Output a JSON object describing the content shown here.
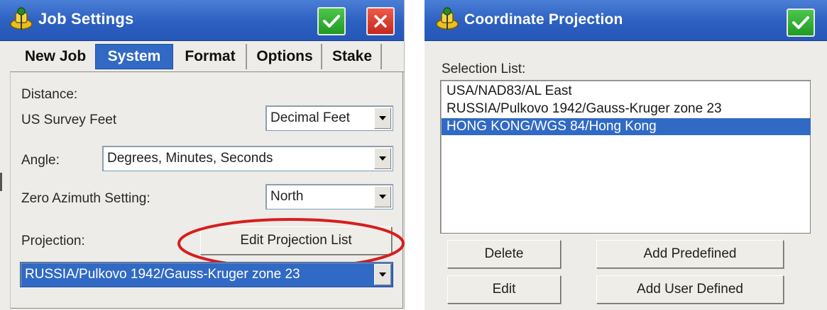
{
  "job_settings": {
    "title": "Job Settings",
    "tabs": [
      {
        "label": "New Job"
      },
      {
        "label": "System"
      },
      {
        "label": "Format"
      },
      {
        "label": "Options"
      },
      {
        "label": "Stake"
      }
    ],
    "active_tab": "System",
    "distance_label": "Distance:",
    "distance_unit_label": "US Survey Feet",
    "distance_format_value": "Decimal Feet",
    "angle_label": "Angle:",
    "angle_value": "Degrees, Minutes, Seconds",
    "zero_azimuth_label": "Zero Azimuth Setting:",
    "zero_azimuth_value": "North",
    "projection_label": "Projection:",
    "edit_projection_button": "Edit Projection List",
    "projection_value": "RUSSIA/Pulkovo 1942/Gauss-Kruger zone 23"
  },
  "coordinate_projection": {
    "title": "Coordinate Projection",
    "selection_list_label": "Selection List:",
    "items": [
      {
        "label": "USA/NAD83/AL East"
      },
      {
        "label": "RUSSIA/Pulkovo 1942/Gauss-Kruger zone 23"
      },
      {
        "label": "HONG KONG/WGS 84/Hong Kong"
      }
    ],
    "selected_item": "HONG KONG/WGS 84/Hong Kong",
    "buttons": {
      "delete": "Delete",
      "add_predefined": "Add Predefined",
      "edit": "Edit",
      "add_user_defined": "Add User Defined"
    }
  },
  "colors": {
    "titlebar": "#2c5fc0",
    "selection": "#316ac5",
    "ok_button": "#1f9a22",
    "close_button": "#c4281c",
    "highlight_ring": "#d61e1e"
  },
  "icons": [
    "app-logo-icon",
    "checkmark-icon",
    "close-x-icon",
    "dropdown-arrow-icon"
  ]
}
